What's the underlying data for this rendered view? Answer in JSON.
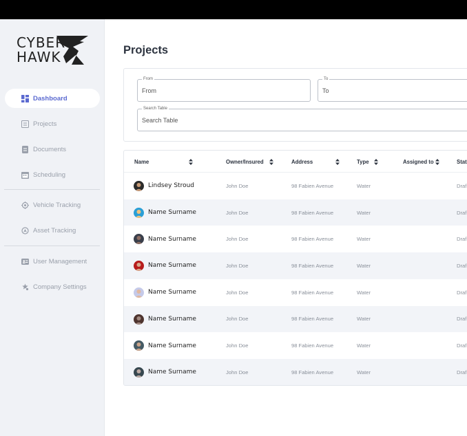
{
  "brand": {
    "line1": "CYBER",
    "line2": "HAWK"
  },
  "sidebar": {
    "items": [
      {
        "label": "Dashboard",
        "icon": "dashboard-icon",
        "active": true
      },
      {
        "label": "Projects",
        "icon": "projects-icon"
      },
      {
        "label": "Documents",
        "icon": "documents-icon"
      },
      {
        "label": "Scheduling",
        "icon": "calendar-icon"
      },
      {
        "label": "Vehicle Tracking",
        "icon": "vehicle-tracking-icon"
      },
      {
        "label": "Asset Tracking",
        "icon": "asset-tracking-icon"
      },
      {
        "label": "User Management",
        "icon": "user-management-icon"
      },
      {
        "label": "Company Settings",
        "icon": "settings-icon"
      }
    ]
  },
  "page": {
    "title": "Projects"
  },
  "filters": {
    "from": {
      "label": "From",
      "placeholder": "From"
    },
    "to": {
      "label": "To",
      "placeholder": "To"
    },
    "search": {
      "label": "Search Table",
      "placeholder": "Search Table"
    }
  },
  "table": {
    "headers": [
      "Name",
      "Owner/Insured",
      "Address",
      "Type",
      "Assigned to",
      "Status"
    ],
    "visible_headers": [
      "Name",
      "Owner/Insured",
      "Address",
      "Type",
      "Assigned to",
      "Stat"
    ],
    "rows": [
      {
        "name": "Lindsey Stroud",
        "owner": "John Doe",
        "address": "98 Fabien Avenue",
        "type": "Water",
        "assigned": "",
        "status": "Draf"
      },
      {
        "name": "Name Surname",
        "owner": "John Doe",
        "address": "98 Fabien Avenue",
        "type": "Water",
        "assigned": "",
        "status": "Draf"
      },
      {
        "name": "Name Surname",
        "owner": "John Doe",
        "address": "98 Fabien Avenue",
        "type": "Water",
        "assigned": "",
        "status": "Draf"
      },
      {
        "name": "Name Surname",
        "owner": "John Doe",
        "address": "98 Fabien Avenue",
        "type": "Water",
        "assigned": "",
        "status": "Draf"
      },
      {
        "name": "Name Surname",
        "owner": "John Doe",
        "address": "98 Fabien Avenue",
        "type": "Water",
        "assigned": "",
        "status": "Draf"
      },
      {
        "name": "Name Surname",
        "owner": "John Doe",
        "address": "98 Fabien Avenue",
        "type": "Water",
        "assigned": "",
        "status": "Draf"
      },
      {
        "name": "Name Surname",
        "owner": "John Doe",
        "address": "98 Fabien Avenue",
        "type": "Water",
        "assigned": "",
        "status": "Draf"
      },
      {
        "name": "Name Surname",
        "owner": "John Doe",
        "address": "98 Fabien Avenue",
        "type": "Water",
        "assigned": "",
        "status": "Draf"
      }
    ]
  },
  "colors": {
    "accent": "#5b6ad0",
    "sidebar_bg": "#f0f2f6",
    "row_alt": "#f2f4f8",
    "topbar": "#000000"
  }
}
